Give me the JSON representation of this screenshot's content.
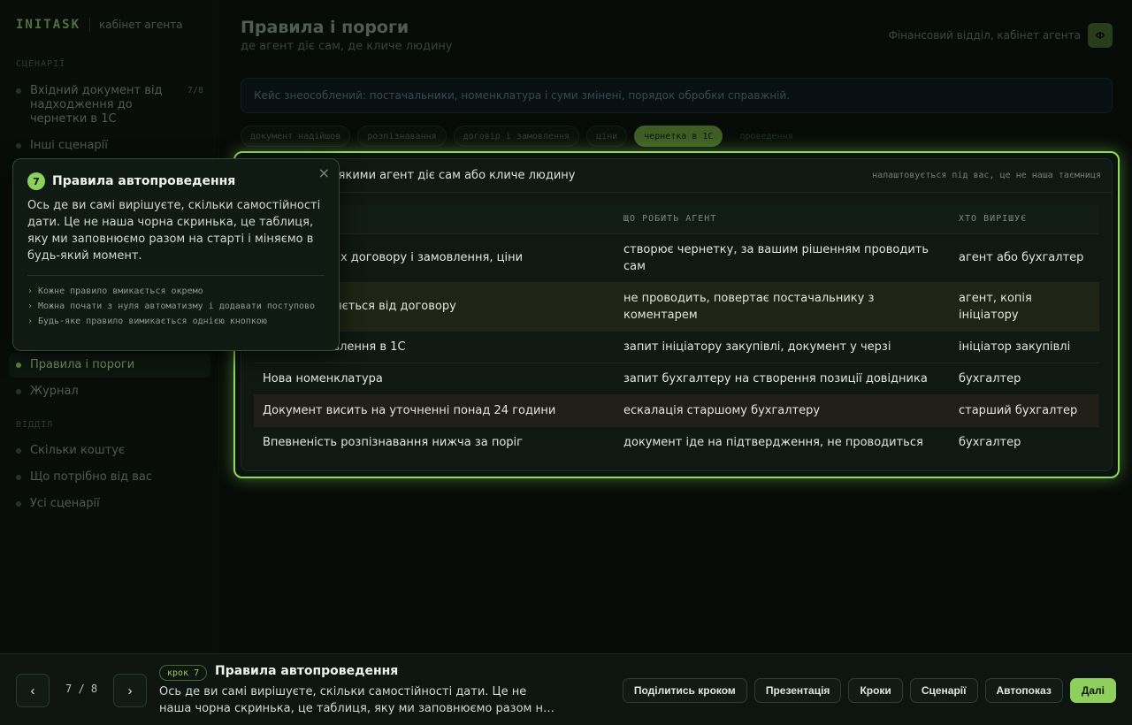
{
  "brand": {
    "logo": "INITASK",
    "subtitle": "кабінет агента"
  },
  "sidebar": {
    "section_scenarios": "СЦЕНАРІЇ",
    "section_other": "ВІДДІЛ",
    "items": [
      {
        "label": "Вхідний документ від надходження до чернетки в 1С",
        "count": "7/8"
      },
      {
        "label": "Інші сценарії"
      },
      {
        "label": "Правила і пороги"
      },
      {
        "label": "Журнал"
      },
      {
        "label": "Скільки коштує"
      },
      {
        "label": "Що потрібно від вас"
      },
      {
        "label": "Усі сценарії"
      }
    ]
  },
  "header": {
    "title": "Правила і пороги",
    "subtitle": "де агент діє сам, де кличе людину",
    "account_label": "Фінансовий відділ, кабінет агента",
    "avatar": "Ф"
  },
  "case_banner": "Кейс знеособлений: постачальники, номенклатура і суми змінені, порядок обробки справжній.",
  "stages": [
    "документ надійшов",
    "розпізнавання",
    "договір і замовлення",
    "ціни",
    "чернетка в 1С",
    "проведення"
  ],
  "rules_card": {
    "title": "Правила, за якими агент діє сам або кличе людину",
    "note": "налаштовується під вас, це не наша таємниця",
    "columns": [
      "",
      "ЩО РОБИТЬ АГЕНТ",
      "ХТО ВИРІШУЄ"
    ],
    "rows": [
      {
        "condition": "Сума в межах договору і замовлення, ціни",
        "action": "створює чернетку, за вашим рішенням проводить сам",
        "who": "агент або бухгалтер"
      },
      {
        "condition": "Ціна відрізняється від договору",
        "action": "не проводить, повертає постачальнику з коментарем",
        "who": "агент, копія ініціатору"
      },
      {
        "condition": "Немає замовлення в 1С",
        "action": "запит ініціатору закупівлі, документ у черзі",
        "who": "ініціатор закупівлі"
      },
      {
        "condition": "Нова номенклатура",
        "action": "запит бухгалтеру на створення позиції довідника",
        "who": "бухгалтер"
      },
      {
        "condition": "Документ висить на уточненні понад 24 години",
        "action": "ескалація старшому бухгалтеру",
        "who": "старший бухгалтер"
      },
      {
        "condition": "Впевненість розпізнавання нижча за поріг",
        "action": "документ іде на підтвердження, не проводиться",
        "who": "бухгалтер"
      }
    ]
  },
  "popover": {
    "number": "7",
    "title": "Правила автопроведення",
    "body": "Ось де ви самі вирішуєте, скільки самостійності дати. Це не наша чорна скринька, це таблиця, яку ми заповнюємо разом на старті і міняємо в будь-який момент.",
    "bullets": [
      "Кожне правило вмикається окремо",
      "Можна почати з нуля автоматизму і додавати поступово",
      "Будь-яке правило вимикається однією кнопкою"
    ],
    "close": "×"
  },
  "bottombar": {
    "prev": "‹",
    "next": "›",
    "counter": "7 / 8",
    "step_badge": "крок 7",
    "step_title": "Правила автопроведення",
    "step_desc": "Ось де ви самі вирішуєте, скільки самостійності дати. Це не наша чорна скринька, це таблиця, яку ми заповнюємо разом на старті і міняємо в будь-який момент.",
    "actions": [
      "Поділитись кроком",
      "Презентація",
      "Кроки",
      "Сценарії",
      "Автопоказ",
      "Далі"
    ]
  },
  "colors": {
    "accent": "#8fd05c",
    "highlight_border": "#8fdc5c"
  }
}
